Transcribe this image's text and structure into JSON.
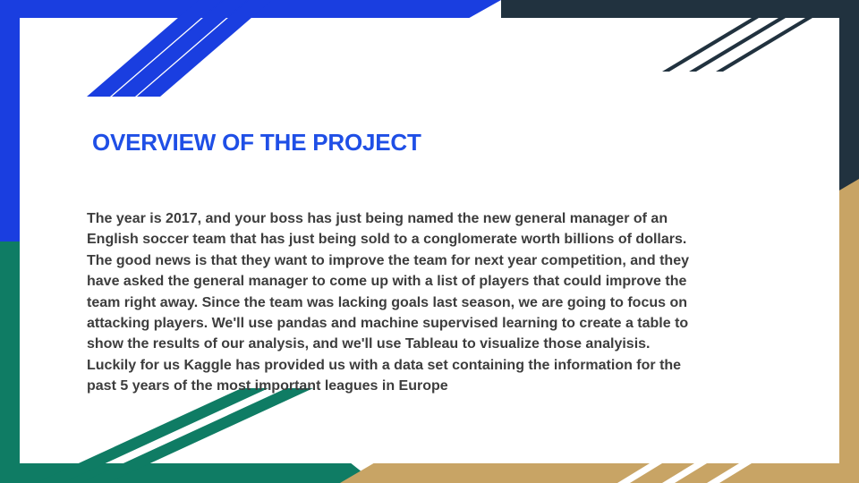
{
  "slide": {
    "title": "OVERVIEW OF THE PROJECT",
    "body_lines": [
      "The year is 2017, and your boss has just being named the new general manager of an",
      "English soccer team that has just being sold to a conglomerate worth billions of dollars.",
      "The good news is that they want to improve the team for next year competition, and they",
      "have asked the general manager to come up with a list of players that could improve the",
      "team right away. Since the team was lacking goals last season, we are going to focus on",
      "attacking players. We'll use pandas and machine supervised learning to create a table to",
      "show the results of our analysis, and we'll use Tableau to visualize those analyisis.",
      "Luckily for us Kaggle has provided us with a data set containing the information for the",
      "past 5 years of the most important leagues in Europe"
    ]
  },
  "colors": {
    "title": "#1f4fe6",
    "body_text": "#3d3d3d",
    "blue": "#1a3ee0",
    "dark_navy": "#21323f",
    "green": "#0f7c64",
    "tan": "#c8a465",
    "white": "#ffffff"
  }
}
